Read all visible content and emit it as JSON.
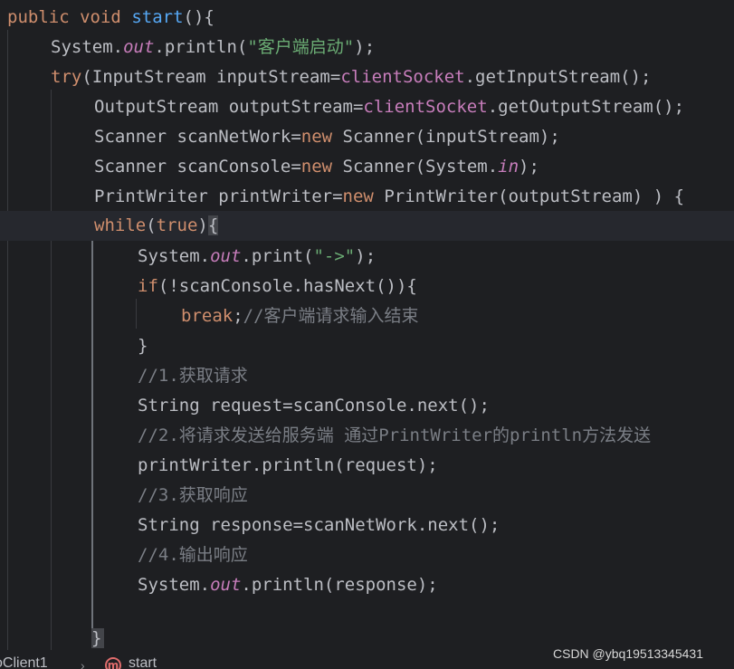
{
  "code": {
    "l1": {
      "kw1": "public",
      "kw2": "void",
      "method": "start",
      "rest": "(){"
    },
    "l2": {
      "a": "System.",
      "out": "out",
      "b": ".println(",
      "str": "\"客户端启动\"",
      "c": ");"
    },
    "l3": {
      "kw": "try",
      "a": "(InputStream inputStream=",
      "field": "clientSocket",
      "b": ".getInputStream();"
    },
    "l4": {
      "a": "OutputStream outputStream=",
      "field": "clientSocket",
      "b": ".getOutputStream();"
    },
    "l5": {
      "a": "Scanner scanNetWork=",
      "kw": "new",
      "b": " Scanner(inputStream);"
    },
    "l6": {
      "a": "Scanner scanConsole=",
      "kw": "new",
      "b": " Scanner(System.",
      "in": "in",
      "c": ");"
    },
    "l7": {
      "a": "PrintWriter printWriter=",
      "kw": "new",
      "b": " PrintWriter(outputStream) ) {"
    },
    "l8": {
      "kw1": "while",
      "a": "(",
      "kw2": "true",
      "b": ")",
      "brace": "{"
    },
    "l9": {
      "a": "System.",
      "out": "out",
      "b": ".print(",
      "str": "\"->\"",
      "c": ");"
    },
    "l10": {
      "kw": "if",
      "a": "(!scanConsole.hasNext()){"
    },
    "l11": {
      "kw": "break",
      "a": ";",
      "cmt": "//客户端请求输入结束"
    },
    "l12": {
      "a": "}"
    },
    "l13": {
      "cmt": "//1.获取请求"
    },
    "l14": {
      "a": "String request=scanConsole.next();"
    },
    "l15": {
      "cmt": "//2.将请求发送给服务端 通过PrintWriter的println方法发送"
    },
    "l16": {
      "a": "printWriter.println(request);"
    },
    "l17": {
      "cmt": "//3.获取响应"
    },
    "l18": {
      "a": "String response=scanNetWork.next();"
    },
    "l19": {
      "cmt": "//4.输出响应"
    },
    "l20": {
      "a": "System.",
      "out": "out",
      "b": ".println(response);"
    },
    "closing_brace": "}"
  },
  "breadcrumb": {
    "class_name": "oClient1",
    "method_icon_letter": "m",
    "method_name": "start"
  },
  "watermark": "CSDN @ybq19513345431",
  "colors": {
    "background": "#1e1f22",
    "keyword": "#cf8e6d",
    "method": "#56a8f5",
    "field": "#c77dbb",
    "string": "#6aab73",
    "comment": "#7a7e85",
    "text": "#bcbec4"
  }
}
